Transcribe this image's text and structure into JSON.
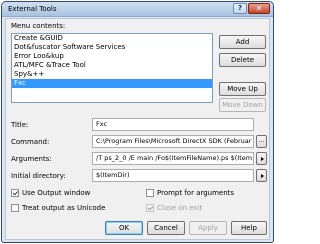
{
  "window": {
    "title": "External Tools",
    "help_glyph": "?",
    "close_glyph": "✕"
  },
  "menu_contents": {
    "label": "Menu contents:",
    "items": [
      {
        "label": "Create &GUID",
        "selected": false
      },
      {
        "label": "Dot&fuscator Software Services",
        "selected": false
      },
      {
        "label": "Error Loo&kup",
        "selected": false
      },
      {
        "label": "ATL/MFC &Trace Tool",
        "selected": false
      },
      {
        "label": "Spy&++",
        "selected": false
      },
      {
        "label": "Fxc",
        "selected": true
      }
    ]
  },
  "side_buttons": {
    "add": "Add",
    "delete": "Delete",
    "move_up": "Move Up",
    "move_down": "Move Down"
  },
  "fields": {
    "title_label": "Title:",
    "title_value": "Fxc",
    "command_label": "Command:",
    "command_value": "C:\\Program Files\\Microsoft DirectX SDK (Februar",
    "command_browse": "...",
    "arguments_label": "Arguments:",
    "arguments_value": "/T ps_2_0  /E main /Fo$(ItemFileName).ps $(Item",
    "initial_dir_label": "Initial directory:",
    "initial_dir_value": "$(ItemDir)"
  },
  "options": {
    "use_output_window": {
      "label": "Use Output window",
      "checked": true,
      "enabled": true
    },
    "treat_output_unicode": {
      "label": "Treat output as Unicode",
      "checked": false,
      "enabled": true
    },
    "prompt_for_arguments": {
      "label": "Prompt for arguments",
      "checked": false,
      "enabled": true
    },
    "close_on_exit": {
      "label": "Close on exit",
      "checked": true,
      "enabled": false
    }
  },
  "footer": {
    "ok": "OK",
    "cancel": "Cancel",
    "apply": "Apply",
    "help": "Help"
  }
}
